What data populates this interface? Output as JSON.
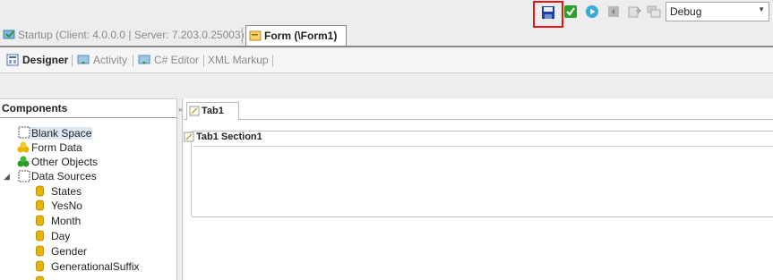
{
  "toolbar": {
    "icons": [
      "save-icon",
      "validate-check-icon",
      "run-icon",
      "stop-icon",
      "export-icon",
      "windows-icon"
    ],
    "debug_value": "Debug"
  },
  "doc_tabs": {
    "startup_label": "Startup (Client: 4.0.0.0 | Server: 7.203.0.25003)",
    "form_label": "Form (\\Form1)"
  },
  "mode_tabs": {
    "designer": "Designer",
    "activity": "Activity",
    "csharp": "C# Editor",
    "xml": "XML Markup"
  },
  "components": {
    "header": "Components",
    "items": [
      {
        "label": "Blank Space"
      },
      {
        "label": "Form Data"
      },
      {
        "label": "Other Objects"
      },
      {
        "label": "Data Sources"
      },
      {
        "label": "States"
      },
      {
        "label": "YesNo"
      },
      {
        "label": "Month"
      },
      {
        "label": "Day"
      },
      {
        "label": "Gender"
      },
      {
        "label": "GenerationalSuffix"
      }
    ]
  },
  "designer": {
    "tab_label": "Tab1",
    "section_label": "Tab1 Section1"
  },
  "colors": {
    "highlight": "#e01818",
    "selection": "#dde8f5",
    "database": "#e8b400"
  }
}
